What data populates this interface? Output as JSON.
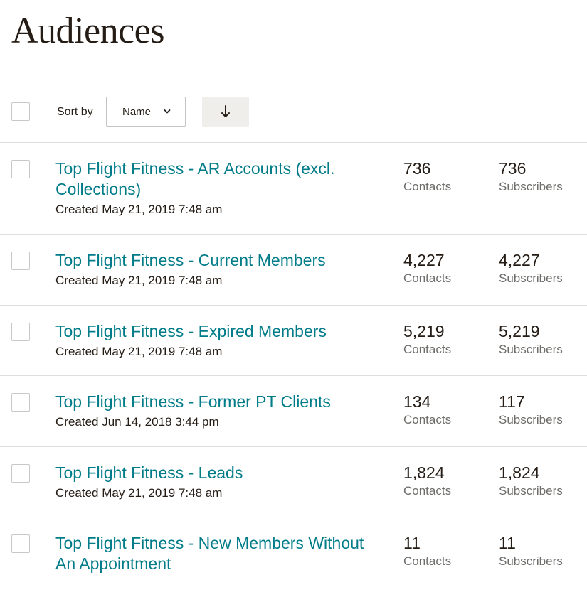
{
  "page": {
    "title": "Audiences"
  },
  "toolbar": {
    "sort_label": "Sort by",
    "sort_value": "Name",
    "sort_direction_icon": "arrow-down-icon",
    "chevron_icon": "chevron-down-icon"
  },
  "audiences": [
    {
      "name_line1": "Top Flight Fitness - AR Accounts (excl.",
      "name_line2": "Collections)",
      "created": "Created May 21, 2019 7:48 am",
      "contacts": "736",
      "contacts_label": "Contacts",
      "subscribers": "736",
      "subscribers_label": "Subscribers"
    },
    {
      "name_line1": "Top Flight Fitness - Current Members",
      "name_line2": "",
      "created": "Created May 21, 2019 7:48 am",
      "contacts": "4,227",
      "contacts_label": "Contacts",
      "subscribers": "4,227",
      "subscribers_label": "Subscribers"
    },
    {
      "name_line1": "Top Flight Fitness - Expired Members",
      "name_line2": "",
      "created": "Created May 21, 2019 7:48 am",
      "contacts": "5,219",
      "contacts_label": "Contacts",
      "subscribers": "5,219",
      "subscribers_label": "Subscribers"
    },
    {
      "name_line1": "Top Flight Fitness - Former PT Clients",
      "name_line2": "",
      "created": "Created Jun 14, 2018 3:44 pm",
      "contacts": "134",
      "contacts_label": "Contacts",
      "subscribers": "117",
      "subscribers_label": "Subscribers"
    },
    {
      "name_line1": "Top Flight Fitness - Leads",
      "name_line2": "",
      "created": "Created May 21, 2019 7:48 am",
      "contacts": "1,824",
      "contacts_label": "Contacts",
      "subscribers": "1,824",
      "subscribers_label": "Subscribers"
    },
    {
      "name_line1": "Top Flight Fitness - New Members Without",
      "name_line2": "An Appointment",
      "created": "",
      "contacts": "11",
      "contacts_label": "Contacts",
      "subscribers": "11",
      "subscribers_label": "Subscribers"
    }
  ]
}
